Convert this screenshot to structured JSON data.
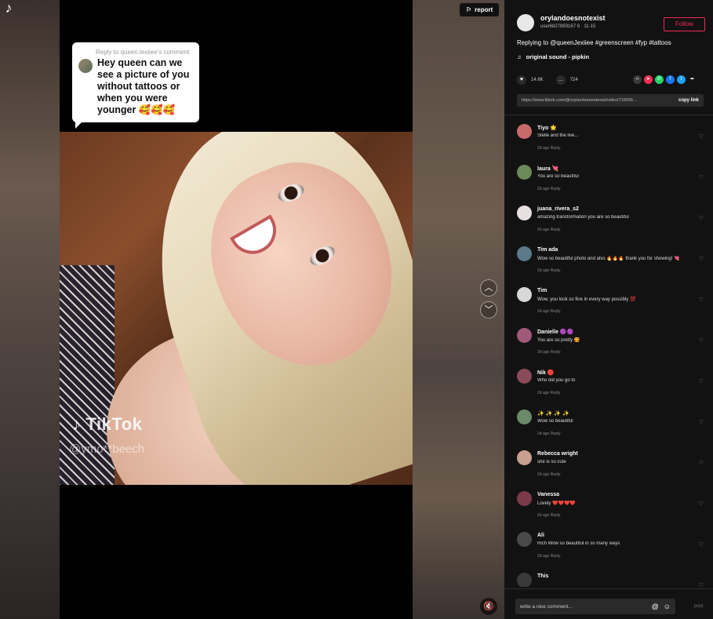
{
  "app": {
    "logo_glyph": "♪"
  },
  "video": {
    "report_label": "report",
    "watermark_brand": "TikTok",
    "watermark_user": "@ymo**beech",
    "reply_bubble": {
      "reply_to": "Reply to queen.lexiiee's comment",
      "text": "Hey queen can we see a picture of you without tattoos or when you were younger 🥰🥰🥰"
    }
  },
  "author": {
    "name": "orylandoesnotexist",
    "sub": "user6827893167 6 · 11-15",
    "follow_label": "Follow"
  },
  "post": {
    "description": "Replying to @queenJexiiee #greenscreen #fyp #tattoos",
    "sound": "original sound - pipkin",
    "likes": "14.6K",
    "comments": "724",
    "link": "https://www.tiktok.com/@orylandoesnotexist/video/716556...",
    "copy_label": "copy link"
  },
  "comments": [
    {
      "name": "Tiyo 🌟",
      "text": "Stelle and the live...",
      "meta": "2d ago   Reply",
      "color": "#c96a6a"
    },
    {
      "name": "laura 💘",
      "text": "You are so beautiful",
      "meta": "2d ago   Reply",
      "color": "#6b8a5a"
    },
    {
      "name": "juana_rivera_s2",
      "text": "amazing transformation you are so beautiful",
      "meta": "2d ago   Reply",
      "color": "#e8e0e0"
    },
    {
      "name": "Tim ada",
      "text": "Wow so beautiful photo and also 🔥🔥🔥 thank you for showing! 💘",
      "meta": "2d ago   Reply",
      "color": "#5a7a8a"
    },
    {
      "name": "Tim",
      "text": "Wow, you look so fine in every way possibly 💯",
      "meta": "2d ago   Reply",
      "color": "#d8d8d8"
    },
    {
      "name": "Danielle 🟣🟣",
      "text": "You are so pretty 🥰",
      "meta": "2d ago   Reply",
      "color": "#a05a7a"
    },
    {
      "name": "Nik 🔴",
      "text": "Who did you go to",
      "meta": "2d ago   Reply",
      "color": "#8a4a5a"
    },
    {
      "name": "✨ ✨ ✨ ✨",
      "text": "Wow so beautiful",
      "meta": "2d ago   Reply",
      "color": "#6a8a6a"
    },
    {
      "name": "Rebecca wright",
      "text": "she is so cute",
      "meta": "2d ago   Reply",
      "color": "#c8a090"
    },
    {
      "name": "Vanessa",
      "text": "Lovely ❤️❤️❤️❤️",
      "meta": "2d ago   Reply",
      "color": "#7a3a4a"
    },
    {
      "name": "Ali",
      "text": "Rich Wow so beautiful in so many ways",
      "meta": "2d ago   Reply",
      "color": "#4a4a4a"
    },
    {
      "name": "This",
      "text": "",
      "meta": "",
      "color": "#3a3a3a"
    }
  ],
  "composer": {
    "placeholder": "write a nice comment...",
    "post_label": "post"
  }
}
